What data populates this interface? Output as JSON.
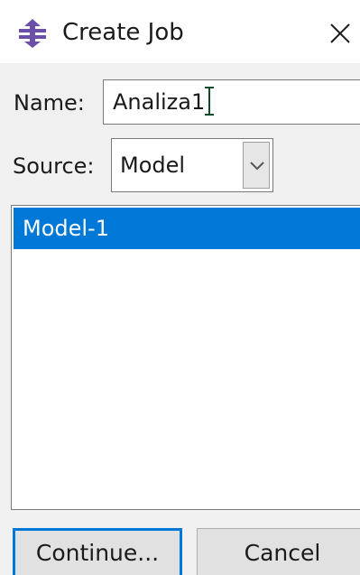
{
  "dialog": {
    "title": "Create Job",
    "icon": "job-icon",
    "close_icon": "close-icon"
  },
  "form": {
    "name_label": "Name:",
    "name_value": "Analiza1",
    "source_label": "Source:",
    "source_value": "Model"
  },
  "model_list": {
    "items": [
      {
        "label": "Model-1",
        "selected": true
      }
    ]
  },
  "buttons": {
    "continue_label": "Continue...",
    "cancel_label": "Cancel"
  },
  "colors": {
    "selection": "#0078d7",
    "focus_border": "#0078d7",
    "icon_purple": "#6b4fa8"
  }
}
